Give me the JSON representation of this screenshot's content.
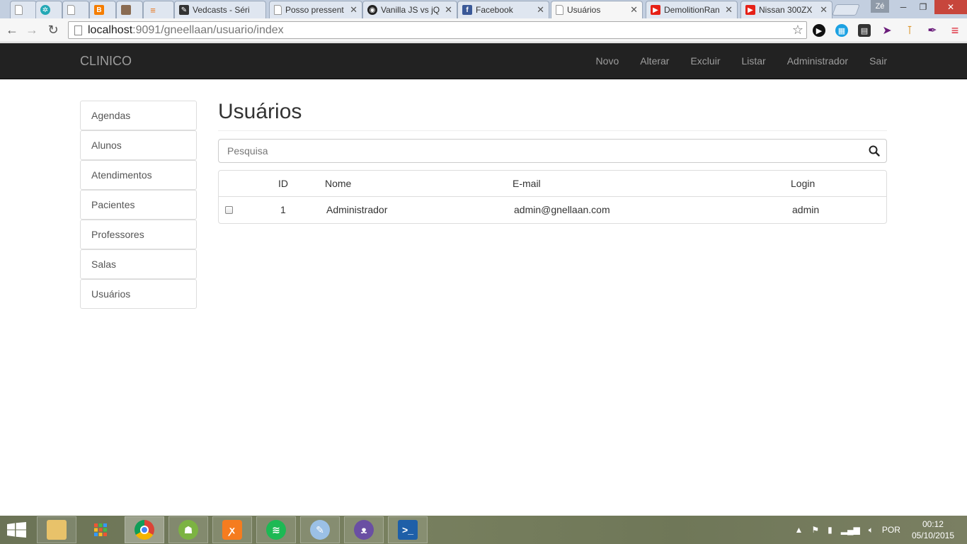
{
  "browser": {
    "tabs": [
      {
        "label": "",
        "favicon": "page-icon"
      },
      {
        "label": "",
        "favicon": "gear-icon"
      },
      {
        "label": "",
        "favicon": "page-icon"
      },
      {
        "label": "",
        "favicon": "blogger-icon"
      },
      {
        "label": "",
        "favicon": "avatar-icon"
      },
      {
        "label": "",
        "favicon": "stackoverflow-icon"
      },
      {
        "label": "Vedcasts - Séri",
        "favicon": "pen-icon"
      },
      {
        "label": "Posso pressent",
        "favicon": "page-icon"
      },
      {
        "label": "Vanilla JS vs jQ",
        "favicon": "github-icon"
      },
      {
        "label": "Facebook",
        "favicon": "facebook-icon"
      },
      {
        "label": "Usuários",
        "favicon": "page-icon",
        "active": true
      },
      {
        "label": "DemolitionRan",
        "favicon": "youtube-icon"
      },
      {
        "label": "Nissan 300ZX",
        "favicon": "youtube-icon"
      }
    ],
    "close_glyph": "✕",
    "profile": "Zé",
    "address": {
      "host": "localhost",
      "path": ":9091/gneellaan/usuario/index"
    }
  },
  "navbar": {
    "brand": "CLINICO",
    "links": [
      "Novo",
      "Alterar",
      "Excluir",
      "Listar",
      "Administrador",
      "Sair"
    ]
  },
  "sidebar": {
    "items": [
      "Agendas",
      "Alunos",
      "Atendimentos",
      "Pacientes",
      "Professores",
      "Salas",
      "Usuários"
    ]
  },
  "main": {
    "title": "Usuários",
    "search": {
      "placeholder": "Pesquisa"
    },
    "table": {
      "headers": [
        "ID",
        "Nome",
        "E-mail",
        "Login"
      ],
      "rows": [
        {
          "id": "1",
          "nome": "Administrador",
          "email": "admin@gnellaan.com",
          "login": "admin"
        }
      ]
    }
  },
  "taskbar": {
    "language": "POR",
    "time": "00:12",
    "date": "05/10/2015"
  }
}
